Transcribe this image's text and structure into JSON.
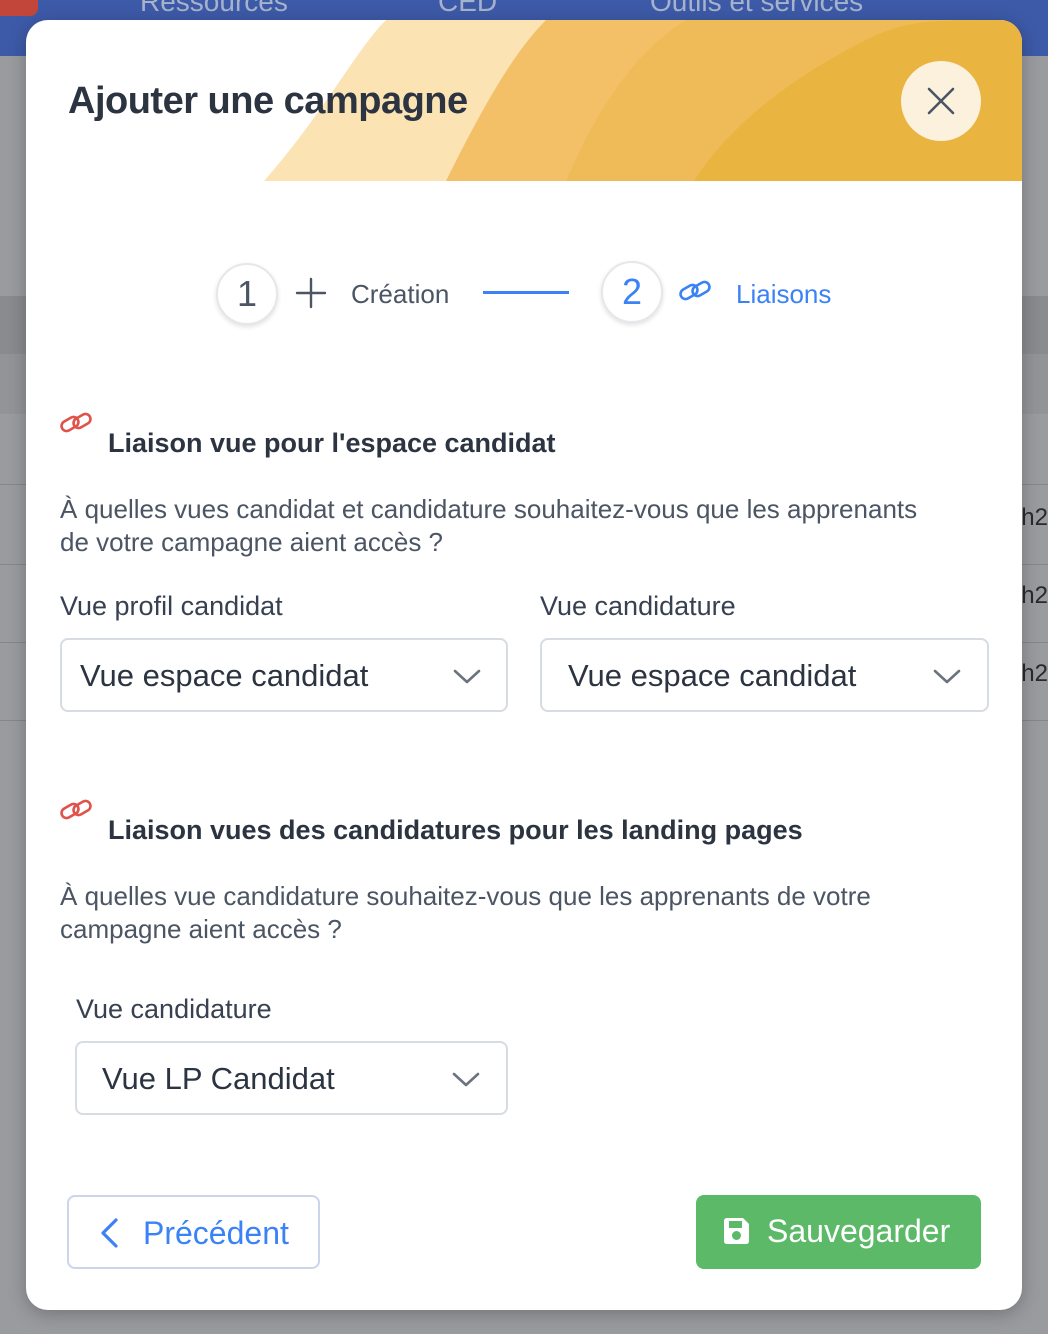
{
  "background": {
    "nav_items": [
      "Ressources",
      "CED",
      "Outils et services"
    ],
    "table_cells": [
      "h2",
      "h2",
      "h2"
    ]
  },
  "modal": {
    "title": "Ajouter une campagne",
    "close_icon": "close-icon",
    "colors": {
      "header_light": "#fbe3b3",
      "header_mid": "#f4c067",
      "header_dark": "#e9b43f",
      "accent_blue": "#3b82f6",
      "link_red": "#e0524a",
      "save_green": "#5cb968"
    }
  },
  "stepper": {
    "steps": [
      {
        "number": "1",
        "label": "Création",
        "icon": "plus-icon"
      },
      {
        "number": "2",
        "label": "Liaisons",
        "icon": "link-icon"
      }
    ]
  },
  "section1": {
    "icon": "link-icon",
    "title": "Liaison vue pour l'espace candidat",
    "description": "À quelles vues candidat et candidature souhaitez-vous que les apprenants de votre campagne aient accès ?",
    "fields": [
      {
        "label": "Vue profil candidat",
        "value": "Vue espace candidat"
      },
      {
        "label": "Vue candidature",
        "value": "Vue espace candidat"
      }
    ]
  },
  "section2": {
    "icon": "link-icon",
    "title": "Liaison vues des candidatures pour les landing pages",
    "description": "À quelles vue candidature souhaitez-vous que les apprenants de votre campagne aient accès ?",
    "fields": [
      {
        "label": "Vue candidature",
        "value": "Vue LP Candidat"
      }
    ]
  },
  "footer": {
    "previous_label": "Précédent",
    "save_label": "Sauvegarder"
  }
}
